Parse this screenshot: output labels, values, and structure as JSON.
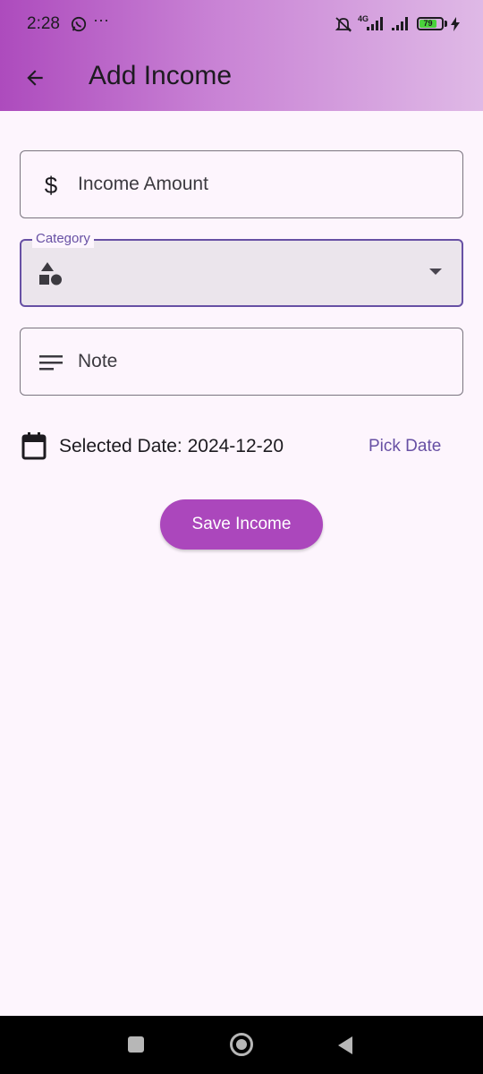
{
  "status_bar": {
    "time": "2:28",
    "more": "···",
    "network": "4G",
    "battery": "79",
    "battery_level": 0.79
  },
  "app_bar": {
    "title": "Add Income",
    "back_icon": "arrow-back-icon"
  },
  "form": {
    "amount": {
      "placeholder": "Income Amount",
      "value": "",
      "icon": "dollar-icon"
    },
    "amount_symbol": "$",
    "category": {
      "label": "Category",
      "icon": "category-shapes-icon",
      "value": ""
    },
    "note": {
      "placeholder": "Note",
      "value": "",
      "icon": "notes-icon"
    },
    "date_text": "Selected Date: 2024-12-20",
    "pick_date": "Pick Date",
    "save_label": "Save Income"
  },
  "colors": {
    "accent": "#6750a4",
    "button": "#ab47bc",
    "background": "#fdf5fd",
    "header_start": "#ad4bbd",
    "header_end": "#dfb9e6"
  }
}
